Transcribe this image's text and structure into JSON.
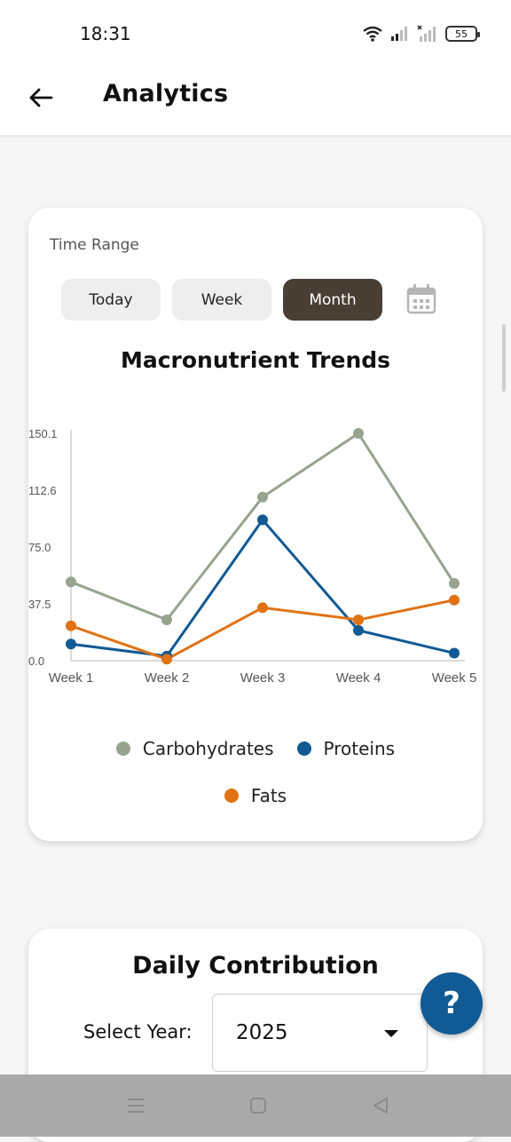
{
  "status_bar": {
    "time": "18:31",
    "battery": "55"
  },
  "app_bar": {
    "title": "Analytics"
  },
  "time_range": {
    "label": "Time Range",
    "options": [
      "Today",
      "Week",
      "Month"
    ],
    "selected": "Month"
  },
  "chart_title": "Macronutrient Trends",
  "chart_data": {
    "type": "line",
    "title": "Macronutrient Trends",
    "categories": [
      "Week 1",
      "Week 2",
      "Week 3",
      "Week 4",
      "Week 5"
    ],
    "y_ticks": [
      "150.1",
      "112.6",
      "75.0",
      "37.5",
      "0.0"
    ],
    "ylim": [
      0,
      150.1
    ],
    "grid": false,
    "legend_position": "bottom",
    "series": [
      {
        "name": "Carbohydrates",
        "color": "#97a38f",
        "values": [
          52,
          27,
          108,
          150.1,
          51
        ]
      },
      {
        "name": "Proteins",
        "color": "#115a93",
        "values": [
          11,
          3,
          93,
          20,
          5
        ]
      },
      {
        "name": "Fats",
        "color": "#e07214",
        "values": [
          23,
          1,
          35,
          27,
          40
        ]
      }
    ]
  },
  "daily": {
    "title": "Daily Contribution",
    "year_label": "Select Year:",
    "year_value": "2025"
  },
  "fab": {
    "label": "?"
  },
  "icons": [
    "back-arrow-icon",
    "calendar-icon",
    "wifi-icon",
    "signal-icon",
    "battery-icon",
    "dropdown-caret-icon",
    "menu-icon",
    "home-icon",
    "back-triangle-icon"
  ]
}
